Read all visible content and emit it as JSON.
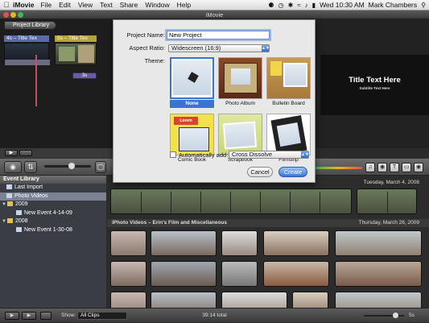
{
  "menubar": {
    "app": "iMovie",
    "items": [
      "File",
      "Edit",
      "View",
      "Text",
      "Share",
      "Window",
      "Help"
    ],
    "clock": "Wed 10:30 AM",
    "user": "Mark Chambers"
  },
  "window": {
    "title": "iMovie"
  },
  "project_library": {
    "button": "Project Library",
    "clip1": "4s – Title Tex",
    "clip2": "5s – Title Tex",
    "duration_badge": "3s"
  },
  "viewer": {
    "title": "Title Text Here",
    "subtitle": "Subtitle Text Here"
  },
  "dialog": {
    "name_label": "Project Name:",
    "name_value": "New Project",
    "aspect_label": "Aspect Ratio:",
    "aspect_value": "Widescreen (16:9)",
    "theme_label": "Theme:",
    "themes": [
      "None",
      "Photo Album",
      "Bulletin Board",
      "Comic Book",
      "Scrapbook",
      "Filmstrip"
    ],
    "selected_theme": "None",
    "auto_add_label": "Automatically add:",
    "auto_add_value": "Cross Dissolve",
    "cancel": "Cancel",
    "create": "Create",
    "comic_caption": "Lorem Ipsum"
  },
  "event_library": {
    "header": "Event Library",
    "items": [
      {
        "label": "Last Import",
        "level": 0,
        "selected": false
      },
      {
        "label": "Photo Videos",
        "level": 0,
        "selected": true
      },
      {
        "label": "2009",
        "level": 0,
        "selected": false
      },
      {
        "label": "New Event 4-14-09",
        "level": 1,
        "selected": false
      },
      {
        "label": "2008",
        "level": 0,
        "selected": false
      },
      {
        "label": "New Event 1-30-08",
        "level": 1,
        "selected": false
      }
    ]
  },
  "event_browser": {
    "date1": "Tuesday, March 4, 2008",
    "event2_title": "iPhoto Videos – Erin's Film and Miscellaneous",
    "date2": "Thursday, March 26, 2009"
  },
  "bottombar": {
    "show_label": "Show:",
    "show_value": "All Clips",
    "total": "39:14 total",
    "zoom": "5s"
  },
  "colors": {
    "selection_blue": "#3a74d3",
    "playhead": "#c0506a",
    "clip_purple": "#6a5aa8"
  }
}
